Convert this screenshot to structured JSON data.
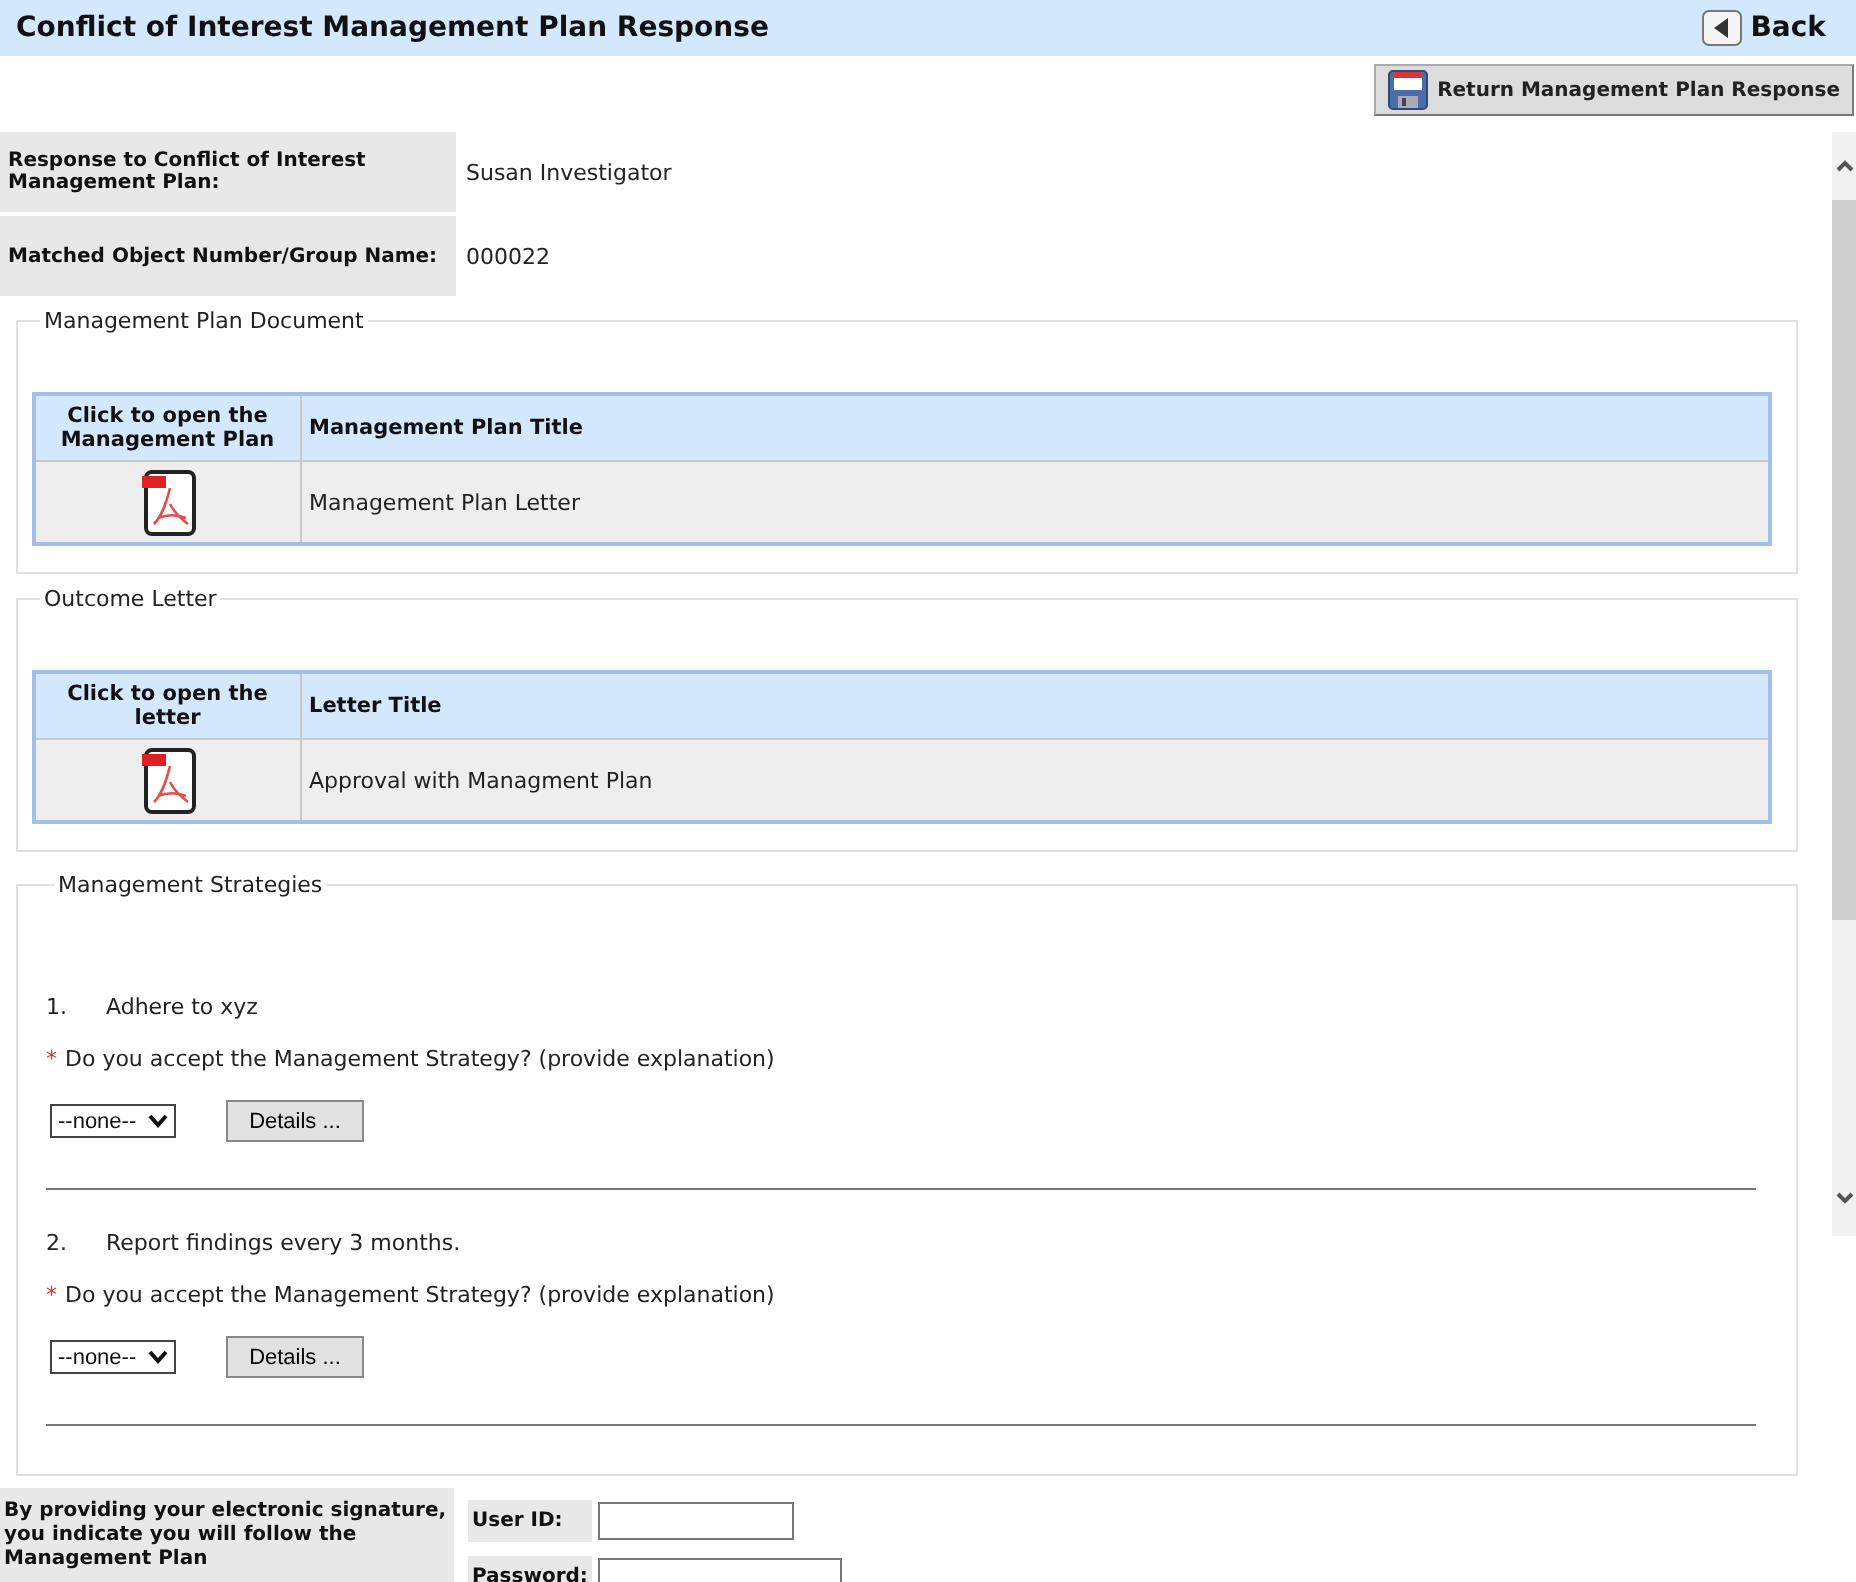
{
  "header": {
    "title": "Conflict of Interest Management Plan Response",
    "back_button": "Back"
  },
  "toolbar": {
    "button": "Return Management Plan Response"
  },
  "info": [
    {
      "label": "Response to Conflict of Interest Management Plan:",
      "value": "Susan Investigator"
    },
    {
      "label": "Matched Object Number/Group Name:",
      "value": "000022"
    }
  ],
  "sections": [
    {
      "legend": "Management Plan Document",
      "columns": [
        "Click to open the Management Plan",
        "Management Plan Title"
      ],
      "rows": [
        {
          "title": "Management Plan Letter"
        }
      ]
    },
    {
      "legend": "Outcome Letter",
      "columns": [
        "Click to open the letter",
        "Letter Title"
      ],
      "rows": [
        {
          "title": "Approval with Managment Plan"
        }
      ]
    }
  ],
  "strategies": {
    "legend": "Management Strategies",
    "items": [
      {
        "number": "1.",
        "text": "Adhere to xyz",
        "required_mark": "*",
        "question": "Do you accept the Management Strategy? (provide explanation)",
        "select_value": "--none--",
        "details_button": "Details ..."
      },
      {
        "number": "2.",
        "text": "Report findings every 3 months.",
        "required_mark": "*",
        "question": "Do you accept the Management Strategy? (provide explanation)",
        "select_value": "--none--",
        "details_button": "Details ..."
      }
    ]
  },
  "signature": {
    "statement": "By providing your electronic signature, you indicate you will follow the Management Plan",
    "fields": [
      {
        "label": "User ID:"
      },
      {
        "label": "Password:"
      }
    ]
  }
}
